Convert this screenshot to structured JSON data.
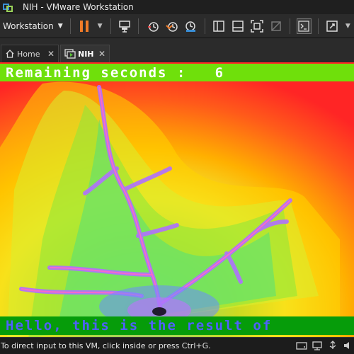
{
  "window": {
    "title": "NIH - VMware Workstation"
  },
  "toolbar": {
    "menu_label": "Workstation"
  },
  "tabs": [
    {
      "label": "Home"
    },
    {
      "label": "NIH"
    }
  ],
  "vm_screen": {
    "top_text": "Remaining seconds :   6",
    "bottom_text": "Hello, this is the result of",
    "colors": {
      "banner_green": "#6fe00b",
      "bottom_green": "#069c0a",
      "text_blue": "#5060ff"
    }
  },
  "statusbar": {
    "text": "To direct input to this VM, click inside or press Ctrl+G."
  }
}
